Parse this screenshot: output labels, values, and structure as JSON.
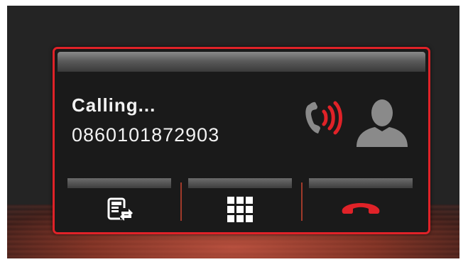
{
  "call": {
    "status_text": "Calling...",
    "phone_number": "0860101872903"
  },
  "icons": {
    "ringing": "phone-ringing-icon",
    "contact": "contact-avatar-icon",
    "transfer": "call-transfer-icon",
    "keypad": "dialpad-icon",
    "hangup": "hang-up-icon"
  },
  "colors": {
    "border": "#e02228",
    "ringing_waves": "#e02228",
    "hangup": "#e02228",
    "avatar": "#8a8a8a"
  }
}
